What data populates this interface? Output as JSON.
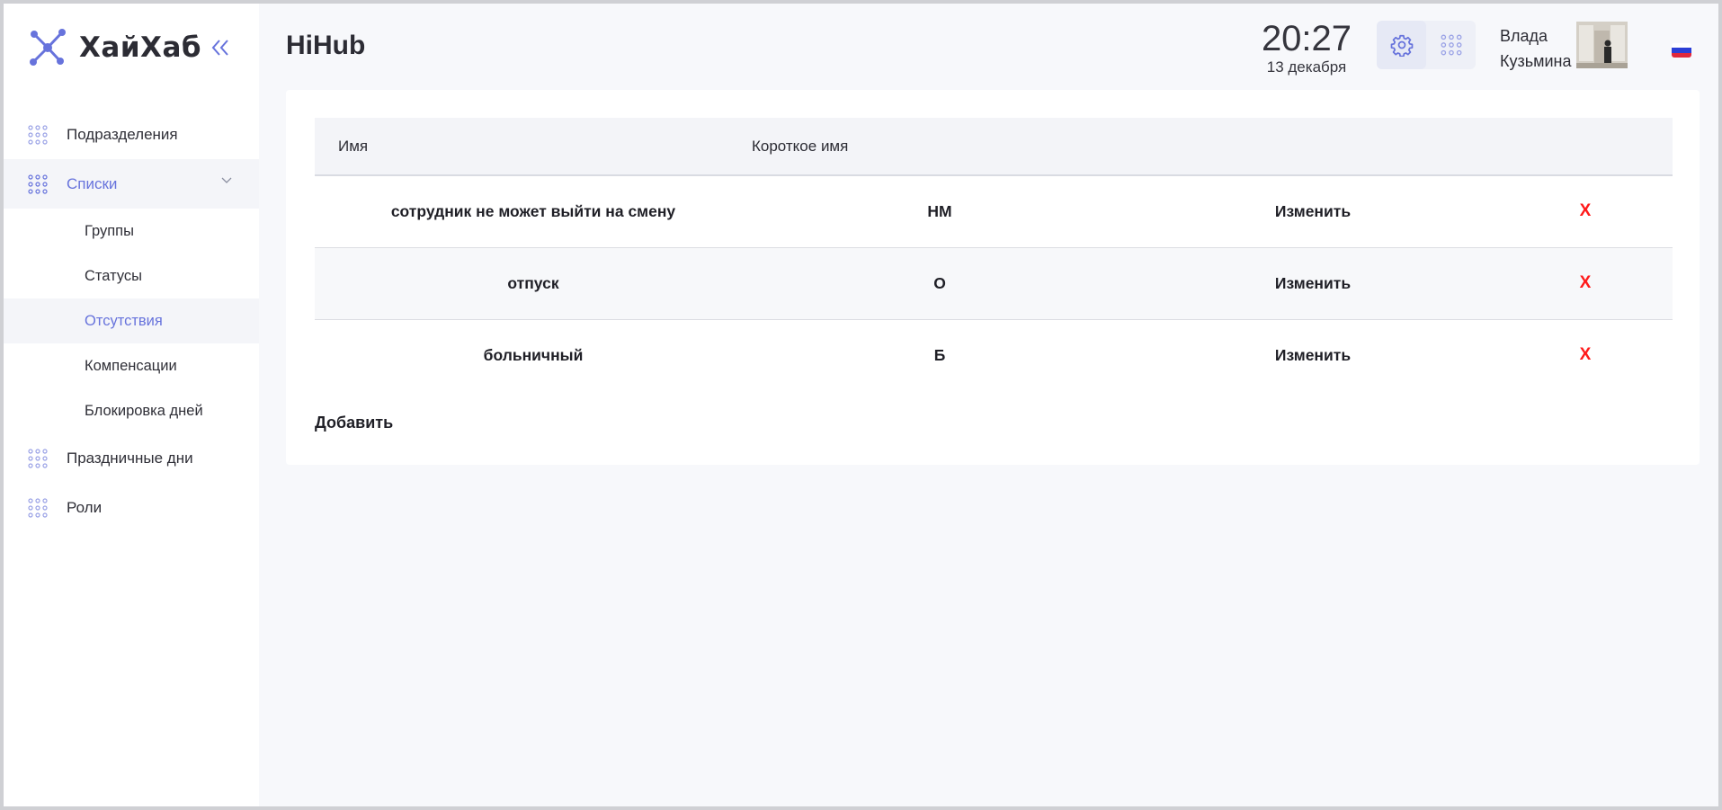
{
  "app": {
    "logo_text": "ХайХаб",
    "page_title": "HiHub"
  },
  "sidebar": {
    "items": [
      {
        "label": "Подразделения",
        "icon": "dots-grid-icon"
      },
      {
        "label": "Списки",
        "icon": "dots-grid-icon",
        "expanded": true
      },
      {
        "label": "Праздничные дни",
        "icon": "dots-grid-icon"
      },
      {
        "label": "Роли",
        "icon": "dots-grid-icon"
      }
    ],
    "subitems": [
      {
        "label": "Группы"
      },
      {
        "label": "Статусы"
      },
      {
        "label": "Отсутствия",
        "active": true
      },
      {
        "label": "Компенсации"
      },
      {
        "label": "Блокировка дней"
      }
    ]
  },
  "header": {
    "time": "20:27",
    "date": "13 декабря",
    "user_first": "Влада",
    "user_last": "Кузьмина",
    "language": "ru"
  },
  "table": {
    "columns": [
      "Имя",
      "Короткое имя"
    ],
    "rows": [
      {
        "name": "сотрудник не может выйти на смену",
        "short": "НМ",
        "edit": "Изменить",
        "delete": "X"
      },
      {
        "name": "отпуск",
        "short": "О",
        "edit": "Изменить",
        "delete": "X"
      },
      {
        "name": "больничный",
        "short": "Б",
        "edit": "Изменить",
        "delete": "X"
      }
    ],
    "add_label": "Добавить"
  },
  "colors": {
    "accent": "#6773dc",
    "delete": "#ff1a1a",
    "background": "#f7f8fb"
  }
}
